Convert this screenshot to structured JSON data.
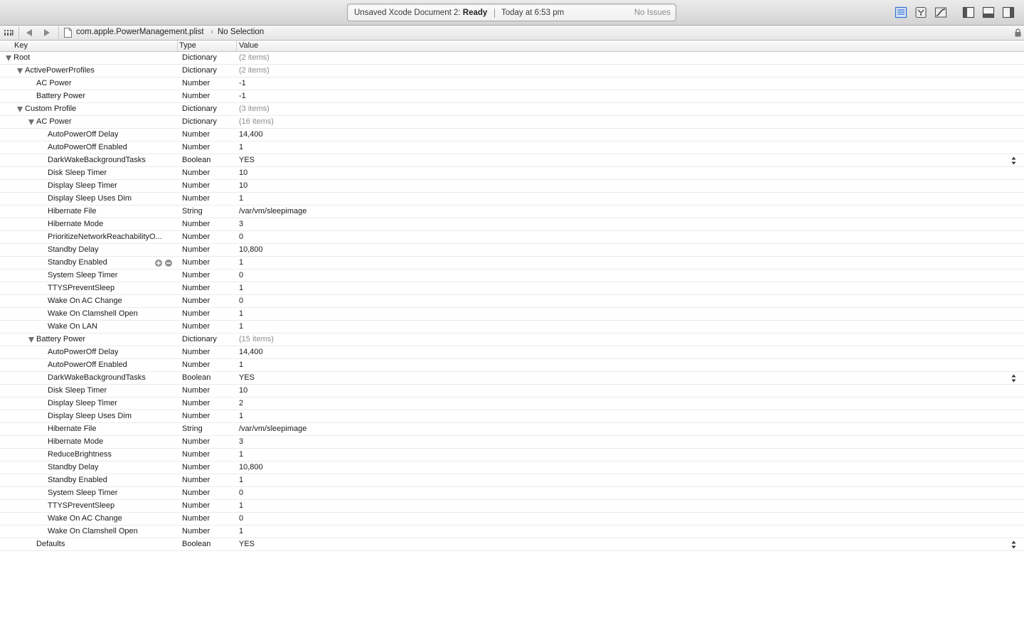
{
  "toolbar": {
    "status_prefix": "Unsaved Xcode Document 2: ",
    "status_bold": "Ready",
    "time": "Today at 6:53 pm",
    "issues": "No Issues"
  },
  "jumpbar": {
    "file": "com.apple.PowerManagement.plist",
    "selection": "No Selection"
  },
  "columns": {
    "key": "Key",
    "type": "Type",
    "value": "Value"
  },
  "rows": [
    {
      "key": "Root",
      "type": "Dictionary",
      "value": "(2 items)",
      "depth": 0,
      "expander": true,
      "dim": true
    },
    {
      "key": "ActivePowerProfiles",
      "type": "Dictionary",
      "value": "(2 items)",
      "depth": 1,
      "expander": true,
      "dim": true
    },
    {
      "key": "AC Power",
      "type": "Number",
      "value": "-1",
      "depth": 2
    },
    {
      "key": "Battery Power",
      "type": "Number",
      "value": "-1",
      "depth": 2
    },
    {
      "key": "Custom Profile",
      "type": "Dictionary",
      "value": "(3 items)",
      "depth": 1,
      "expander": true,
      "dim": true
    },
    {
      "key": "AC Power",
      "type": "Dictionary",
      "value": "(16 items)",
      "depth": 2,
      "expander": true,
      "dim": true
    },
    {
      "key": "AutoPowerOff Delay",
      "type": "Number",
      "value": "14,400",
      "depth": 3
    },
    {
      "key": "AutoPowerOff Enabled",
      "type": "Number",
      "value": "1",
      "depth": 3
    },
    {
      "key": "DarkWakeBackgroundTasks",
      "type": "Boolean",
      "value": "YES",
      "depth": 3,
      "stepper": true
    },
    {
      "key": "Disk Sleep Timer",
      "type": "Number",
      "value": "10",
      "depth": 3
    },
    {
      "key": "Display Sleep Timer",
      "type": "Number",
      "value": "10",
      "depth": 3
    },
    {
      "key": "Display Sleep Uses Dim",
      "type": "Number",
      "value": "1",
      "depth": 3
    },
    {
      "key": "Hibernate File",
      "type": "String",
      "value": "/var/vm/sleepimage",
      "depth": 3
    },
    {
      "key": "Hibernate Mode",
      "type": "Number",
      "value": "3",
      "depth": 3
    },
    {
      "key": "PrioritizeNetworkReachabilityO...",
      "type": "Number",
      "value": "0",
      "depth": 3
    },
    {
      "key": "Standby Delay",
      "type": "Number",
      "value": "10,800",
      "depth": 3
    },
    {
      "key": "Standby Enabled",
      "type": "Number",
      "value": "1",
      "depth": 3,
      "rowbuttons": true
    },
    {
      "key": "System Sleep Timer",
      "type": "Number",
      "value": "0",
      "depth": 3
    },
    {
      "key": "TTYSPreventSleep",
      "type": "Number",
      "value": "1",
      "depth": 3
    },
    {
      "key": "Wake On AC Change",
      "type": "Number",
      "value": "0",
      "depth": 3
    },
    {
      "key": "Wake On Clamshell Open",
      "type": "Number",
      "value": "1",
      "depth": 3
    },
    {
      "key": "Wake On LAN",
      "type": "Number",
      "value": "1",
      "depth": 3
    },
    {
      "key": "Battery Power",
      "type": "Dictionary",
      "value": "(15 items)",
      "depth": 2,
      "expander": true,
      "dim": true
    },
    {
      "key": "AutoPowerOff Delay",
      "type": "Number",
      "value": "14,400",
      "depth": 3
    },
    {
      "key": "AutoPowerOff Enabled",
      "type": "Number",
      "value": "1",
      "depth": 3
    },
    {
      "key": "DarkWakeBackgroundTasks",
      "type": "Boolean",
      "value": "YES",
      "depth": 3,
      "stepper": true
    },
    {
      "key": "Disk Sleep Timer",
      "type": "Number",
      "value": "10",
      "depth": 3
    },
    {
      "key": "Display Sleep Timer",
      "type": "Number",
      "value": "2",
      "depth": 3
    },
    {
      "key": "Display Sleep Uses Dim",
      "type": "Number",
      "value": "1",
      "depth": 3
    },
    {
      "key": "Hibernate File",
      "type": "String",
      "value": "/var/vm/sleepimage",
      "depth": 3
    },
    {
      "key": "Hibernate Mode",
      "type": "Number",
      "value": "3",
      "depth": 3
    },
    {
      "key": "ReduceBrightness",
      "type": "Number",
      "value": "1",
      "depth": 3
    },
    {
      "key": "Standby Delay",
      "type": "Number",
      "value": "10,800",
      "depth": 3
    },
    {
      "key": "Standby Enabled",
      "type": "Number",
      "value": "1",
      "depth": 3
    },
    {
      "key": "System Sleep Timer",
      "type": "Number",
      "value": "0",
      "depth": 3
    },
    {
      "key": "TTYSPreventSleep",
      "type": "Number",
      "value": "1",
      "depth": 3
    },
    {
      "key": "Wake On AC Change",
      "type": "Number",
      "value": "0",
      "depth": 3
    },
    {
      "key": "Wake On Clamshell Open",
      "type": "Number",
      "value": "1",
      "depth": 3
    },
    {
      "key": "Defaults",
      "type": "Boolean",
      "value": "YES",
      "depth": 2,
      "stepper": true
    }
  ]
}
